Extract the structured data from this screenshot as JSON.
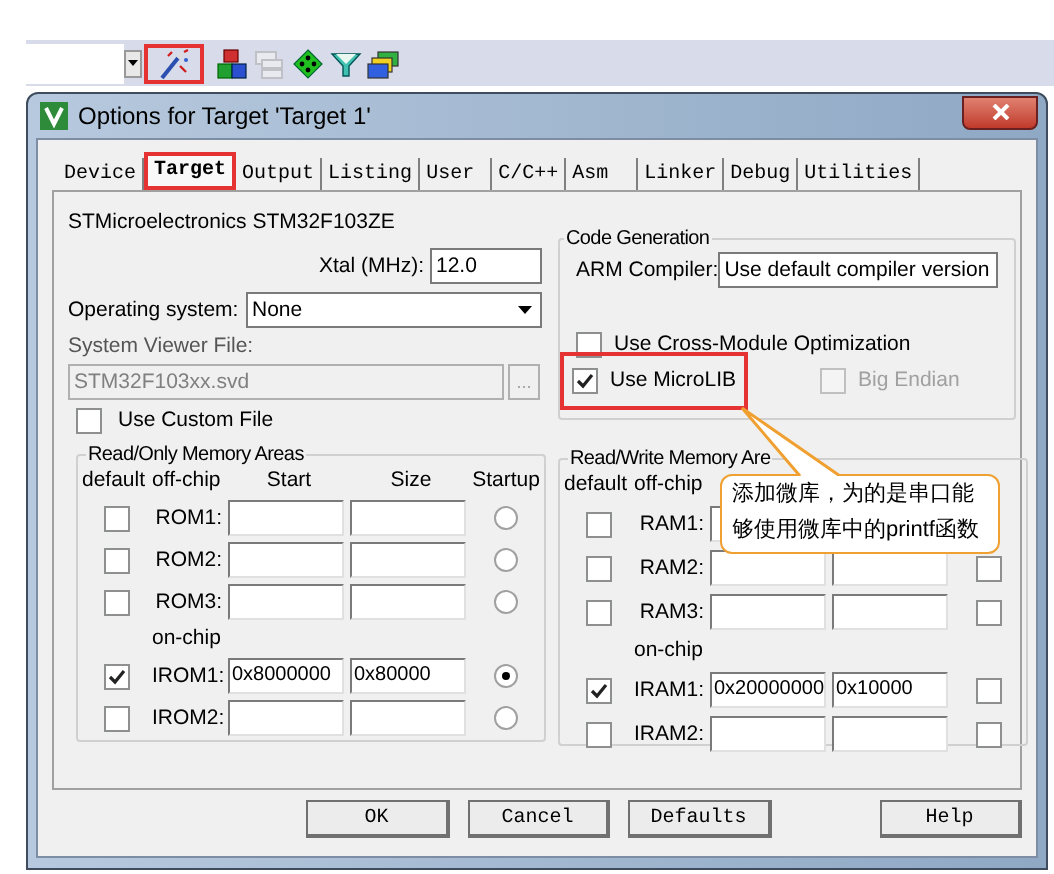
{
  "toolbar": {
    "icons": [
      {
        "kind": "wand",
        "highlighted": true,
        "disabled": false
      },
      {
        "kind": "blocks",
        "highlighted": false,
        "disabled": false
      },
      {
        "kind": "windows",
        "highlighted": false,
        "disabled": true
      },
      {
        "kind": "diamond",
        "highlighted": false,
        "disabled": false
      },
      {
        "kind": "funnel",
        "highlighted": false,
        "disabled": false
      },
      {
        "kind": "chips",
        "highlighted": false,
        "disabled": false
      }
    ]
  },
  "dialog": {
    "title": "Options for Target 'Target 1'",
    "tabs": [
      {
        "label": "Device",
        "selected": false,
        "highlighted": false
      },
      {
        "label": "Target",
        "selected": true,
        "highlighted": true
      },
      {
        "label": "Output",
        "selected": false,
        "highlighted": false
      },
      {
        "label": "Listing",
        "selected": false,
        "highlighted": false
      },
      {
        "label": "User",
        "selected": false,
        "highlighted": false
      },
      {
        "label": "C/C++",
        "selected": false,
        "highlighted": false
      },
      {
        "label": "Asm",
        "selected": false,
        "highlighted": false
      },
      {
        "label": "Linker",
        "selected": false,
        "highlighted": false
      },
      {
        "label": "Debug",
        "selected": false,
        "highlighted": false
      },
      {
        "label": "Utilities",
        "selected": false,
        "highlighted": false
      }
    ],
    "device": "STMicroelectronics STM32F103ZE",
    "xtal": {
      "label": "Xtal (MHz):",
      "value": "12.0"
    },
    "os": {
      "label": "Operating system:",
      "value": "None"
    },
    "svf": {
      "label": "System Viewer File:",
      "value": "STM32F103xx.svd",
      "disabled": true,
      "browse": "..."
    },
    "custom_file": {
      "label": "Use Custom File",
      "checked": false
    },
    "code_generation": {
      "title": "Code Generation",
      "compiler_label": "ARM Compiler:",
      "compiler_value": "Use default compiler version",
      "options": [
        {
          "label": "Use Cross-Module Optimization",
          "checked": false,
          "disabled": false,
          "highlighted": false
        },
        {
          "label": "Use MicroLIB",
          "checked": true,
          "disabled": false,
          "highlighted": true
        },
        {
          "label": "Big Endian",
          "checked": false,
          "disabled": true,
          "highlighted": false
        }
      ]
    },
    "rom": {
      "title": "Read/Only Memory Areas",
      "columns": [
        "default",
        "off-chip",
        "Start",
        "Size",
        "Startup"
      ],
      "groups": [
        {
          "rows": [
            {
              "name": "ROM1:",
              "default": false,
              "startup": false
            },
            {
              "name": "ROM2:",
              "default": false,
              "startup": false
            },
            {
              "name": "ROM3:",
              "default": false,
              "startup": false
            }
          ]
        },
        {
          "label": "on-chip",
          "rows": [
            {
              "name": "IROM1:",
              "default": true,
              "start": "0x8000000",
              "size": "0x80000",
              "startup": true
            },
            {
              "name": "IROM2:",
              "default": false,
              "startup": false
            }
          ]
        }
      ]
    },
    "ram": {
      "title": "Read/Write Memory Are",
      "columns": [
        "default",
        "off-chip"
      ],
      "groups": [
        {
          "rows": [
            {
              "name": "RAM1:",
              "default": false
            },
            {
              "name": "RAM2:",
              "default": false,
              "startup": false
            },
            {
              "name": "RAM3:",
              "default": false,
              "startup": false
            }
          ]
        },
        {
          "label": "on-chip",
          "rows": [
            {
              "name": "IRAM1:",
              "default": true,
              "start": "0x20000000",
              "size": "0x10000",
              "startup": false
            },
            {
              "name": "IRAM2:",
              "default": false,
              "startup": false
            }
          ]
        }
      ]
    },
    "buttons": [
      {
        "label": "OK"
      },
      {
        "label": "Cancel"
      },
      {
        "label": "Defaults"
      },
      {
        "label": "Help"
      }
    ]
  },
  "callout": {
    "text": "添加微库，为的是串口能够使用微库中的printf函数"
  }
}
